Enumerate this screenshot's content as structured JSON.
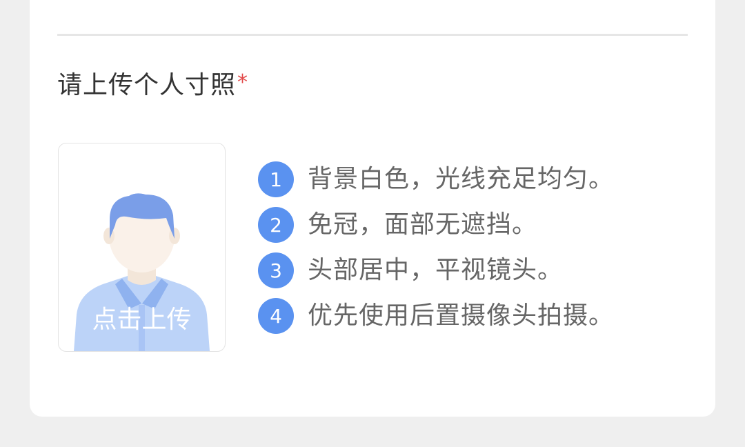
{
  "section": {
    "title": "请上传个人寸照",
    "required_mark": "*"
  },
  "upload": {
    "label": "点击上传"
  },
  "tips": [
    {
      "num": "1",
      "text": "背景白色，光线充足均匀。"
    },
    {
      "num": "2",
      "text": "免冠，面部无遮挡。"
    },
    {
      "num": "3",
      "text": "头部居中，平视镜头。"
    },
    {
      "num": "4",
      "text": "优先使用后置摄像头拍摄。"
    }
  ],
  "colors": {
    "accent": "#5a92f0",
    "required": "#e24a4a",
    "background": "#efefef",
    "card": "#ffffff"
  }
}
